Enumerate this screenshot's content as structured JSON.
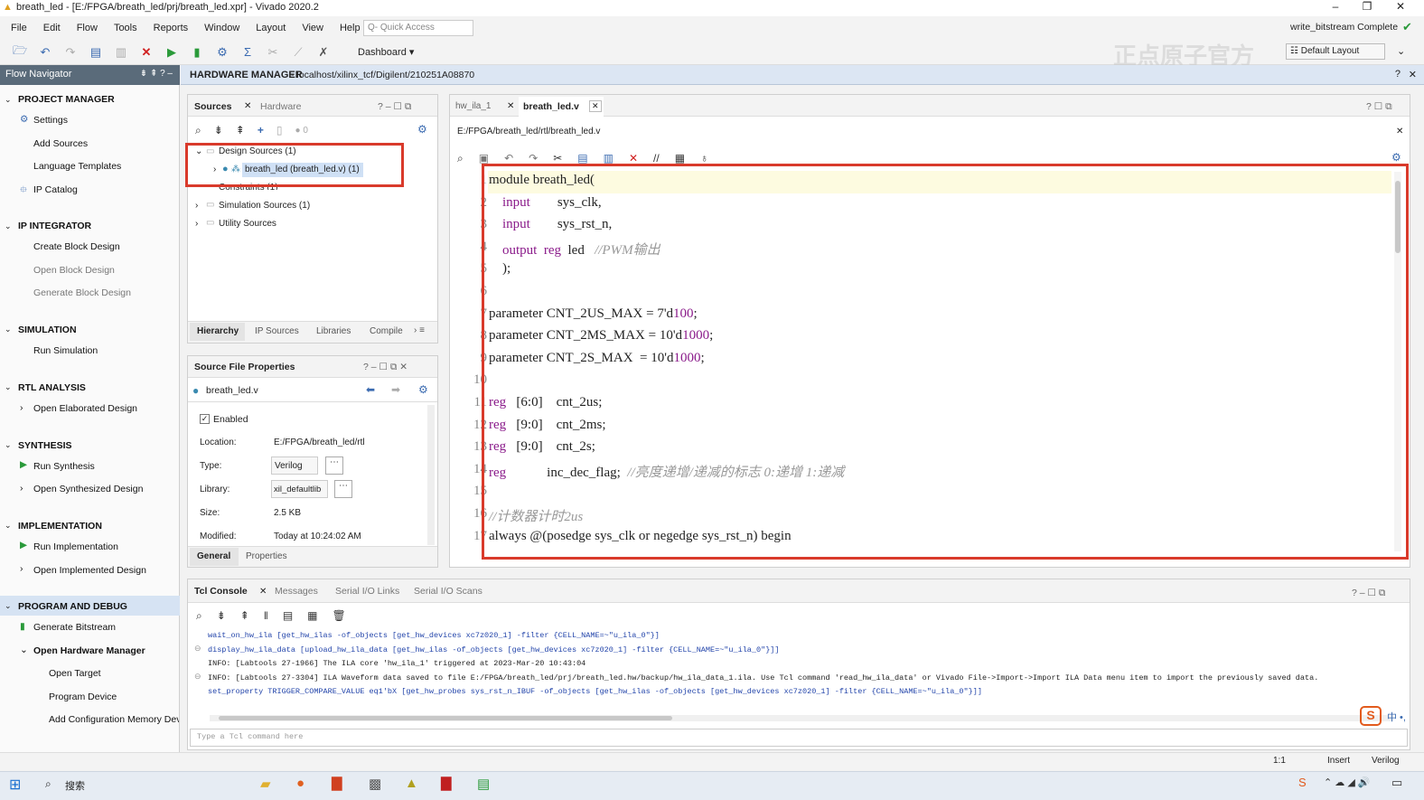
{
  "window": {
    "title": "breath_led - [E:/FPGA/breath_led/prj/breath_led.xpr] - Vivado 2020.2"
  },
  "menu": [
    "File",
    "Edit",
    "Flow",
    "Tools",
    "Reports",
    "Window",
    "Layout",
    "View",
    "Help"
  ],
  "quick_access_placeholder": "Q- Quick Access",
  "status_right": "write_bitstream Complete",
  "layout_label": "Default Layout",
  "dashboard": "Dashboard",
  "watermark": "正点原子官方",
  "flow_navigator": {
    "title": "Flow Navigator",
    "sections": [
      {
        "label": "PROJECT MANAGER",
        "items": [
          "Settings",
          "Add Sources",
          "Language Templates",
          "IP Catalog"
        ]
      },
      {
        "label": "IP INTEGRATOR",
        "items": [
          "Create Block Design",
          "Open Block Design",
          "Generate Block Design"
        ]
      },
      {
        "label": "SIMULATION",
        "items": [
          "Run Simulation"
        ]
      },
      {
        "label": "RTL ANALYSIS",
        "items": [
          "Open Elaborated Design"
        ]
      },
      {
        "label": "SYNTHESIS",
        "items": [
          "Run Synthesis",
          "Open Synthesized Design"
        ]
      },
      {
        "label": "IMPLEMENTATION",
        "items": [
          "Run Implementation",
          "Open Implemented Design"
        ]
      },
      {
        "label": "PROGRAM AND DEBUG",
        "items": [
          "Generate Bitstream",
          "Open Hardware Manager",
          "Open Target",
          "Program Device",
          "Add Configuration Memory Devi"
        ]
      }
    ]
  },
  "hw_header": {
    "title": "HARDWARE MANAGER",
    "path": " - localhost/xilinx_tcf/Digilent/210251A08870"
  },
  "sources": {
    "tabs": [
      "Sources",
      "Hardware"
    ],
    "badge": "0",
    "tree": [
      "Design Sources (1)",
      "breath_led (breath_led.v) (1)",
      "Constraints (1)",
      "Simulation Sources (1)",
      "Utility Sources"
    ],
    "bottom_tabs": [
      "Hierarchy",
      "IP Sources",
      "Libraries",
      "Compile"
    ]
  },
  "properties": {
    "title": "Source File Properties",
    "file": "breath_led.v",
    "enabled": "Enabled",
    "rows": [
      {
        "k": "Location:",
        "v": "E:/FPGA/breath_led/rtl"
      },
      {
        "k": "Type:",
        "v": "Verilog"
      },
      {
        "k": "Library:",
        "v": "xil_defaultlib"
      },
      {
        "k": "Size:",
        "v": "2.5 KB"
      },
      {
        "k": "Modified:",
        "v": "Today at 10:24:02 AM"
      }
    ],
    "bottom_tabs": [
      "General",
      "Properties"
    ]
  },
  "editor": {
    "tabs": [
      "hw_ila_1",
      "breath_led.v"
    ],
    "path": "E:/FPGA/breath_led/rtl/breath_led.v",
    "lines": [
      "module breath_led(",
      "    input        sys_clk,",
      "    input        sys_rst_n,",
      "    output  reg  led   //PWM输出",
      "    );",
      "",
      "parameter CNT_2US_MAX = 7'd100;",
      "parameter CNT_2MS_MAX = 10'd1000;",
      "parameter CNT_2S_MAX  = 10'd1000;",
      "",
      "reg   [6:0]    cnt_2us;",
      "reg   [9:0]    cnt_2ms;",
      "reg   [9:0]    cnt_2s;",
      "reg            inc_dec_flag;  //亮度递增/递减的标志 0:递增 1:递减",
      "",
      "//计数器计时2us",
      "always @(posedge sys_clk or negedge sys_rst_n) begin"
    ]
  },
  "console": {
    "tabs": [
      "Tcl Console",
      "Messages",
      "Serial I/O Links",
      "Serial I/O Scans"
    ],
    "lines": [
      "wait_on_hw_ila [get_hw_ilas -of_objects [get_hw_devices xc7z020_1] -filter {CELL_NAME=~\"u_ila_0\"}]",
      "display_hw_ila_data [upload_hw_ila_data [get_hw_ilas -of_objects [get_hw_devices xc7z020_1] -filter {CELL_NAME=~\"u_ila_0\"}]]",
      "INFO: [Labtools 27-1966] The ILA core 'hw_ila_1' triggered at 2023-Mar-20 10:43:04",
      "INFO: [Labtools 27-3304] ILA Waveform data saved to file E:/FPGA/breath_led/prj/breath_led.hw/backup/hw_ila_data_1.ila. Use Tcl command 'read_hw_ila_data' or Vivado File->Import->Import ILA Data menu item to import the previously saved data.",
      "set_property TRIGGER_COMPARE_VALUE eq1'bX [get_hw_probes sys_rst_n_IBUF -of_objects [get_hw_ilas -of_objects [get_hw_devices xc7z020_1] -filter {CELL_NAME=~\"u_ila_0\"}]]"
    ],
    "input_placeholder": "Type a Tcl command here"
  },
  "statusbar": {
    "pos": "1:1",
    "mode": "Insert",
    "lang": "Verilog"
  },
  "taskbar": {
    "search": "搜索"
  },
  "colors": {
    "highlight_box": "#d93a2b",
    "accent": "#2a6ab0"
  }
}
